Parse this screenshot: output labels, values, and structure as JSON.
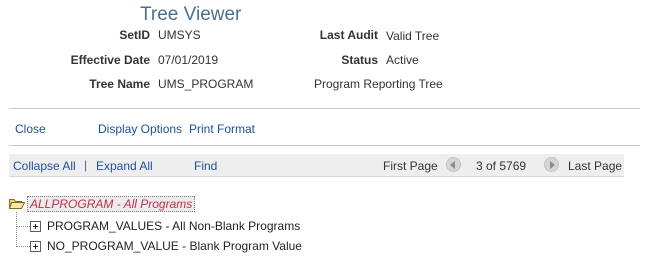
{
  "header": {
    "title": "Tree Viewer",
    "fields": {
      "setid_label": "SetID",
      "setid_value": "UMSYS",
      "effective_date_label": "Effective Date",
      "effective_date_value": "07/01/2019",
      "tree_name_label": "Tree Name",
      "tree_name_value": "UMS_PROGRAM",
      "last_audit_label": "Last Audit",
      "last_audit_value": "Valid Tree",
      "status_label": "Status",
      "status_value": "Active",
      "tree_description": "Program Reporting Tree"
    }
  },
  "actions": {
    "close": "Close",
    "display_options": "Display Options",
    "print_format": "Print Format"
  },
  "navigation": {
    "collapse_all": "Collapse All",
    "separator": "|",
    "expand_all": "Expand All",
    "find": "Find",
    "first_page": "First Page",
    "page_position": "3 of 5769",
    "last_page": "Last Page"
  },
  "tree": {
    "root": {
      "label": "ALLPROGRAM - All Programs",
      "icon": "open-folder-icon"
    },
    "children": [
      {
        "label": "PROGRAM_VALUES - All Non-Blank Programs",
        "icon": "expand-plus-icon"
      },
      {
        "label": "NO_PROGRAM_VALUE - Blank Program Value",
        "icon": "expand-plus-icon"
      }
    ]
  },
  "colors": {
    "title": "#4d6f8f",
    "link": "#1f4e9c",
    "root_node_text": "#c0304c",
    "nav_bar_background": "#eeeeee"
  }
}
